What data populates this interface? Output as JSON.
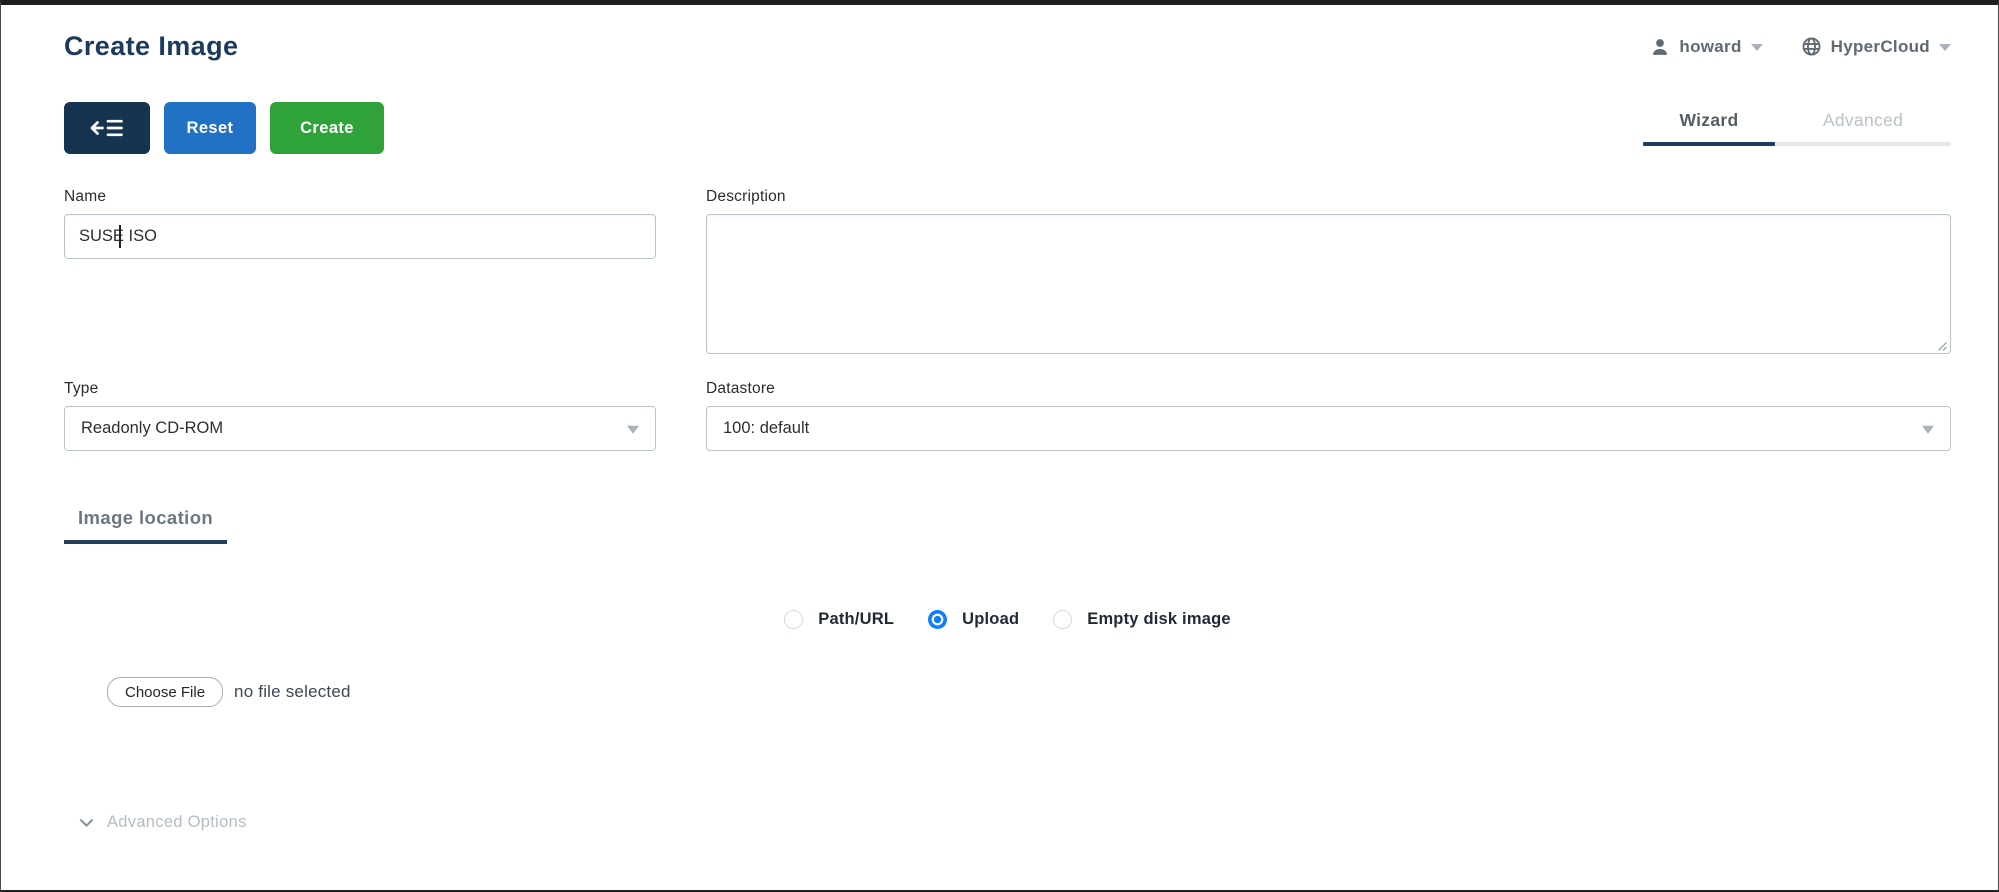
{
  "page": {
    "title": "Create Image"
  },
  "header": {
    "user_menu": {
      "icon": "person-icon",
      "label": "howard"
    },
    "zone_menu": {
      "icon": "globe-icon",
      "label": "HyperCloud"
    }
  },
  "toolbar": {
    "back_button": {
      "icon": "back-to-list-icon"
    },
    "reset_label": "Reset",
    "create_label": "Create"
  },
  "tabs": [
    {
      "label": "Wizard",
      "active": true
    },
    {
      "label": "Advanced",
      "active": false
    }
  ],
  "form": {
    "name": {
      "label": "Name",
      "value": "SUSE ISO"
    },
    "description": {
      "label": "Description",
      "value": ""
    },
    "type": {
      "label": "Type",
      "value": "Readonly CD-ROM"
    },
    "datastore": {
      "label": "Datastore",
      "value": "100: default"
    }
  },
  "image_location": {
    "section_label": "Image location",
    "options": [
      {
        "label": "Path/URL",
        "selected": false
      },
      {
        "label": "Upload",
        "selected": true
      },
      {
        "label": "Empty disk image",
        "selected": false
      }
    ],
    "file_input": {
      "button_label": "Choose File",
      "status": "no file selected"
    }
  },
  "advanced_options": {
    "label": "Advanced Options",
    "icon": "chevron-down-icon"
  },
  "colors": {
    "title_navy": "#1b3a5c",
    "back_button_bg": "#16334f",
    "reset_button_bg": "#2171c4",
    "create_button_bg": "#2fa339",
    "radio_selected_blue": "#0d7eff",
    "active_tab_underline": "#1c3a5e",
    "section_underline": "#24405c",
    "muted_text": "#6b7884",
    "faint_text": "#b3bcc4"
  }
}
